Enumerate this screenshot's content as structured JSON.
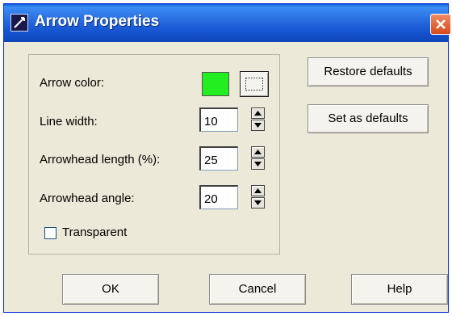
{
  "window": {
    "title": "Arrow Properties"
  },
  "form": {
    "arrow_color_label": "Arrow color:",
    "arrow_color_value": "#22ee22",
    "line_width_label": "Line width:",
    "line_width_value": "10",
    "arrowhead_length_label": "Arrowhead length (%):",
    "arrowhead_length_value": "25",
    "arrowhead_angle_label": "Arrowhead angle:",
    "arrowhead_angle_value": "20",
    "transparent_label": "Transparent",
    "transparent_checked": false
  },
  "side_buttons": {
    "restore_defaults": "Restore defaults",
    "set_as_defaults": "Set as defaults"
  },
  "bottom_buttons": {
    "ok": "OK",
    "cancel": "Cancel",
    "help": "Help"
  },
  "colors": {
    "titlebar": "#2a6fe0",
    "dialog_bg": "#ece9d8",
    "close_button": "#d84a1b"
  },
  "icons": {
    "app": "pencil-line-icon",
    "close": "close-icon",
    "color_picker": "ellipsis-icon",
    "spin_up": "arrow-up-icon",
    "spin_down": "arrow-down-icon"
  }
}
